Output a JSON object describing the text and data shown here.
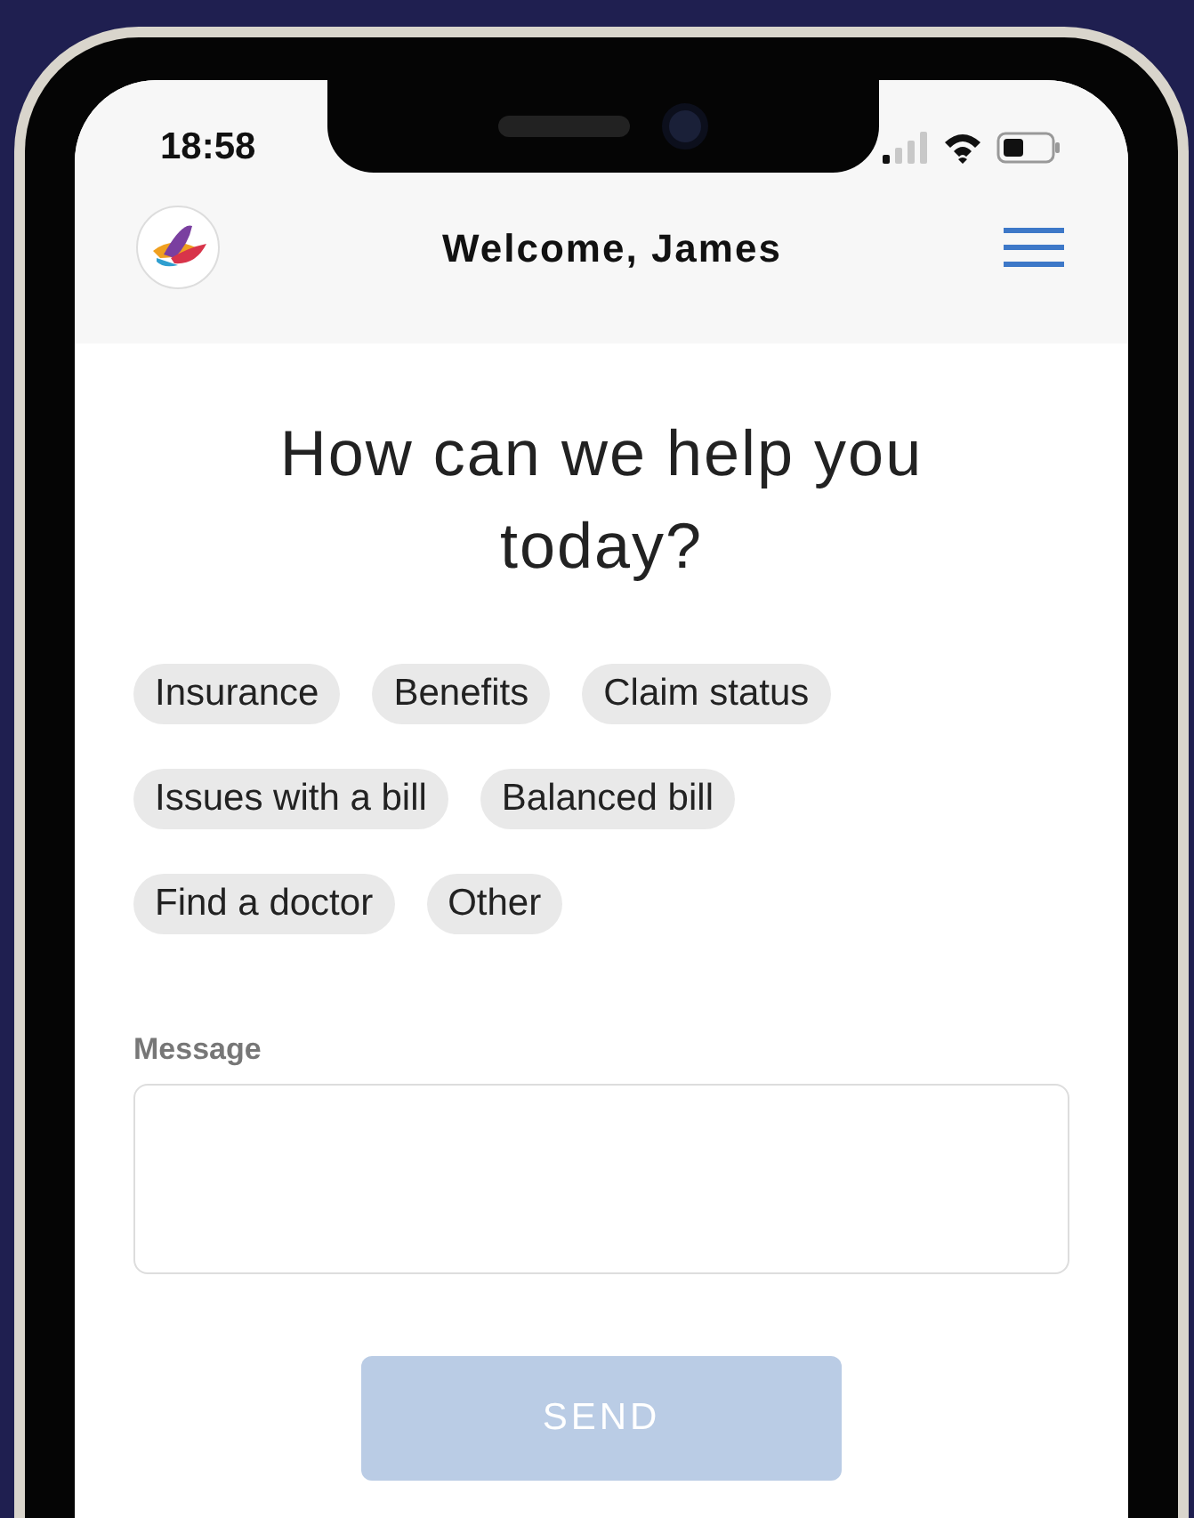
{
  "status_bar": {
    "time": "18:58"
  },
  "header": {
    "title": "Welcome, James"
  },
  "heading": "How can we help you today?",
  "topics": [
    "Insurance",
    "Benefits",
    "Claim status",
    "Issues with a bill",
    "Balanced bill",
    "Find a doctor",
    "Other"
  ],
  "message": {
    "label": "Message"
  },
  "send_button": {
    "label": "SEND",
    "disabled": true
  }
}
